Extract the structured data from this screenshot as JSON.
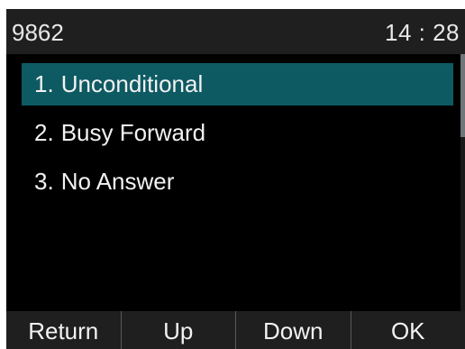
{
  "status_bar": {
    "account": "9862",
    "time": "14 : 28"
  },
  "menu": {
    "items": [
      {
        "number": "1.",
        "label": "Unconditional",
        "selected": true
      },
      {
        "number": "2.",
        "label": "Busy Forward",
        "selected": false
      },
      {
        "number": "3.",
        "label": "No Answer",
        "selected": false
      }
    ]
  },
  "softkeys": {
    "return_label": "Return",
    "up_label": "Up",
    "down_label": "Down",
    "ok_label": "OK"
  },
  "colors": {
    "background": "#1e1f1e",
    "content_background": "#000000",
    "selection": "#0e5a63",
    "text": "#f2f2f2"
  }
}
